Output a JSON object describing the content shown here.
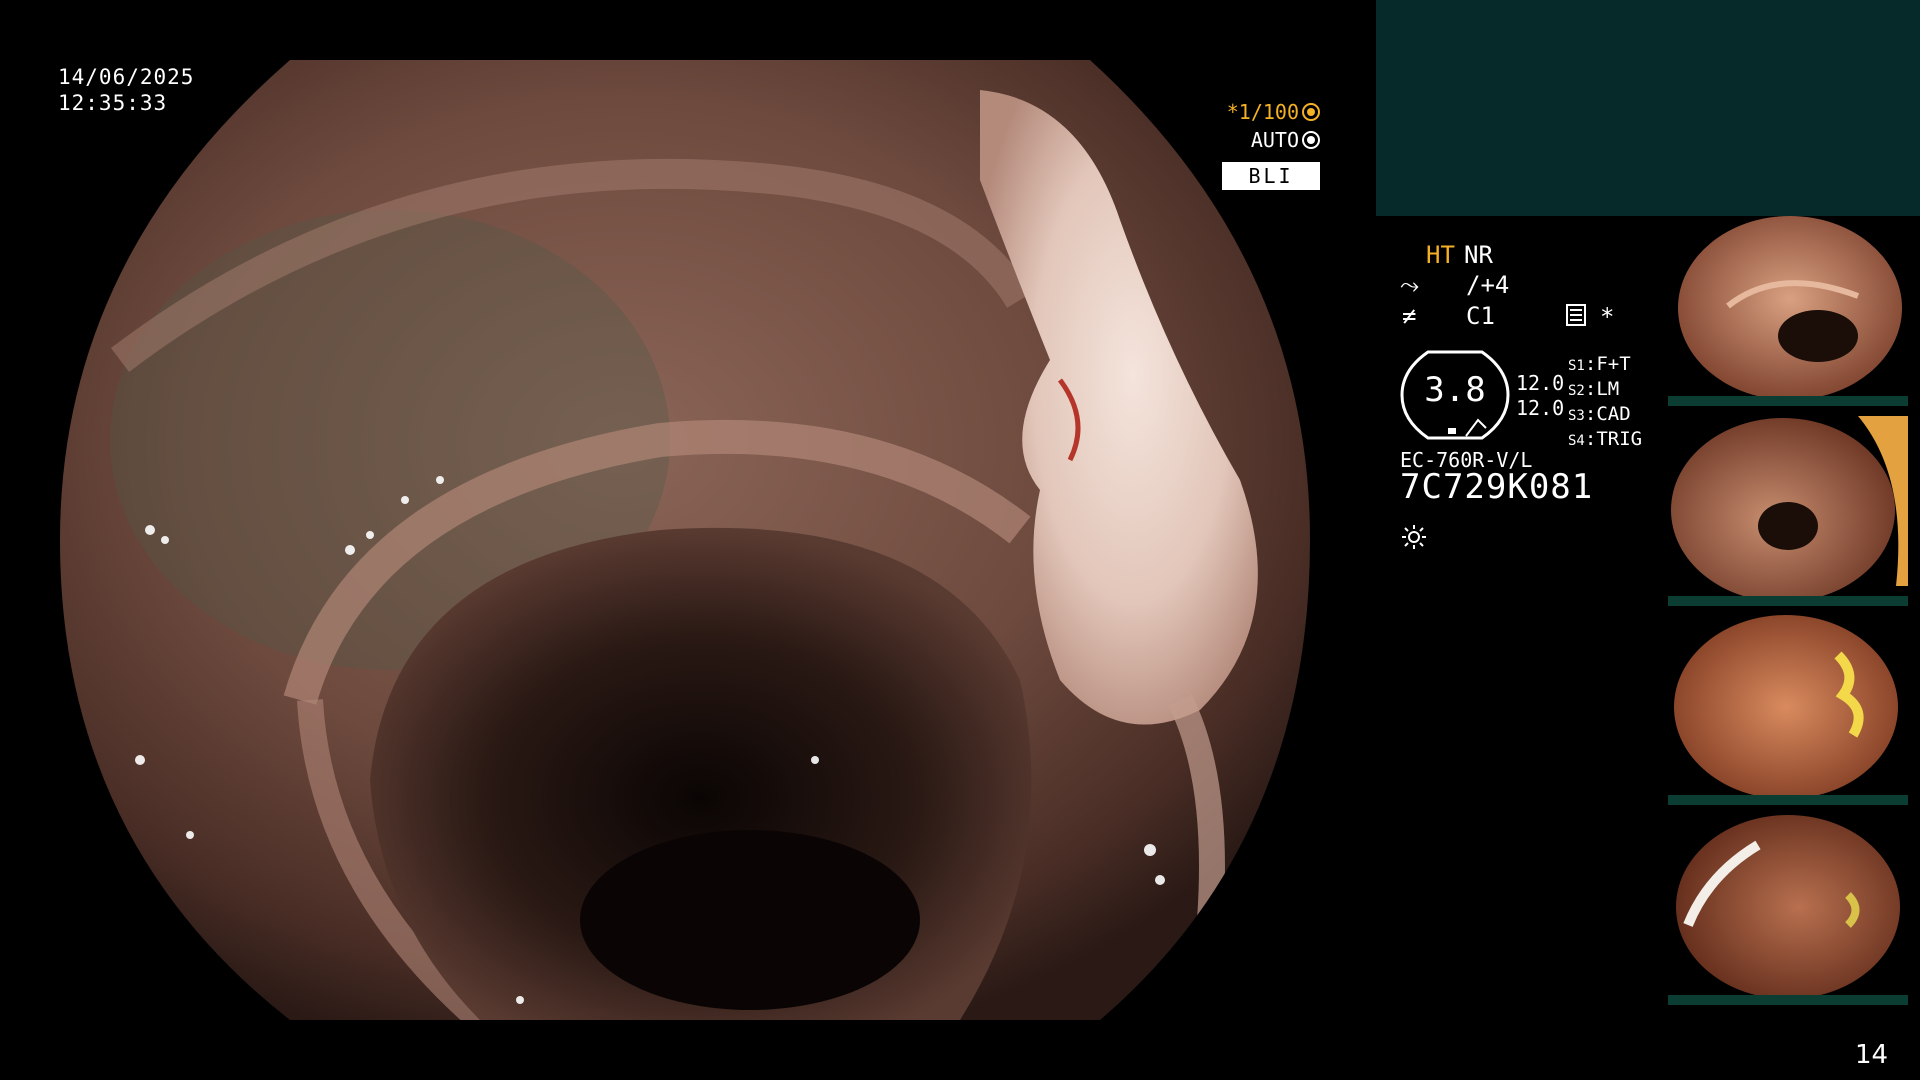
{
  "overlay": {
    "date": "14/06/2025",
    "time": "12:35:33",
    "shutter": "*1/100",
    "exposure": "AUTO",
    "mode": "BLI"
  },
  "info": {
    "ht": "HT",
    "nr": "NR",
    "enhancement": "/+4",
    "color": "C1",
    "star": "*",
    "scope_value": "3.8",
    "pressure_1": "12.0",
    "pressure_2": "12.0",
    "switches": [
      {
        "id": "S1",
        "label": "F+T"
      },
      {
        "id": "S2",
        "label": "LM"
      },
      {
        "id": "S3",
        "label": "CAD"
      },
      {
        "id": "S4",
        "label": "TRIG"
      }
    ],
    "model": "EC-760R-V/L",
    "serial": "7C729K081"
  },
  "colors": {
    "accent_orange": "#f5b126",
    "panel_teal": "#062929",
    "thumb_frame_green": "#0b3d33"
  },
  "icons": [
    "enhancement-icon",
    "color-mode-icon",
    "memo-icon",
    "light-icon",
    "shutter-icon",
    "exposure-icon"
  ],
  "page_number": "14"
}
